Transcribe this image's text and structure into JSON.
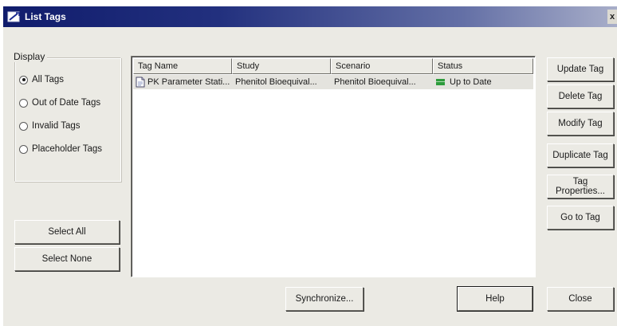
{
  "window": {
    "title": "List Tags",
    "close_glyph": "x"
  },
  "display": {
    "legend": "Display",
    "options": [
      {
        "label": "All Tags",
        "checked": true
      },
      {
        "label": "Out of Date Tags",
        "checked": false
      },
      {
        "label": "Invalid Tags",
        "checked": false
      },
      {
        "label": "Placeholder Tags",
        "checked": false
      }
    ]
  },
  "left_buttons": {
    "select_all": "Select All",
    "select_none": "Select None"
  },
  "table": {
    "columns": [
      "Tag Name",
      "Study",
      "Scenario",
      "Status"
    ],
    "rows": [
      {
        "tag_name": "PK Parameter Stati...",
        "study": "Phenitol Bioequival...",
        "scenario": "Phenitol Bioequival...",
        "status": "Up to Date",
        "status_color": "#2e9c3c"
      }
    ]
  },
  "right_buttons": {
    "update": "Update Tag",
    "delete": "Delete Tag",
    "modify": "Modify Tag",
    "duplicate": "Duplicate Tag",
    "properties": "Tag Properties...",
    "goto": "Go to Tag"
  },
  "bottom_buttons": {
    "synchronize": "Synchronize...",
    "help": "Help",
    "close": "Close"
  },
  "icons": {
    "title": "list-tags-app-icon",
    "row": "document-icon",
    "status": "status-up-to-date-icon"
  }
}
